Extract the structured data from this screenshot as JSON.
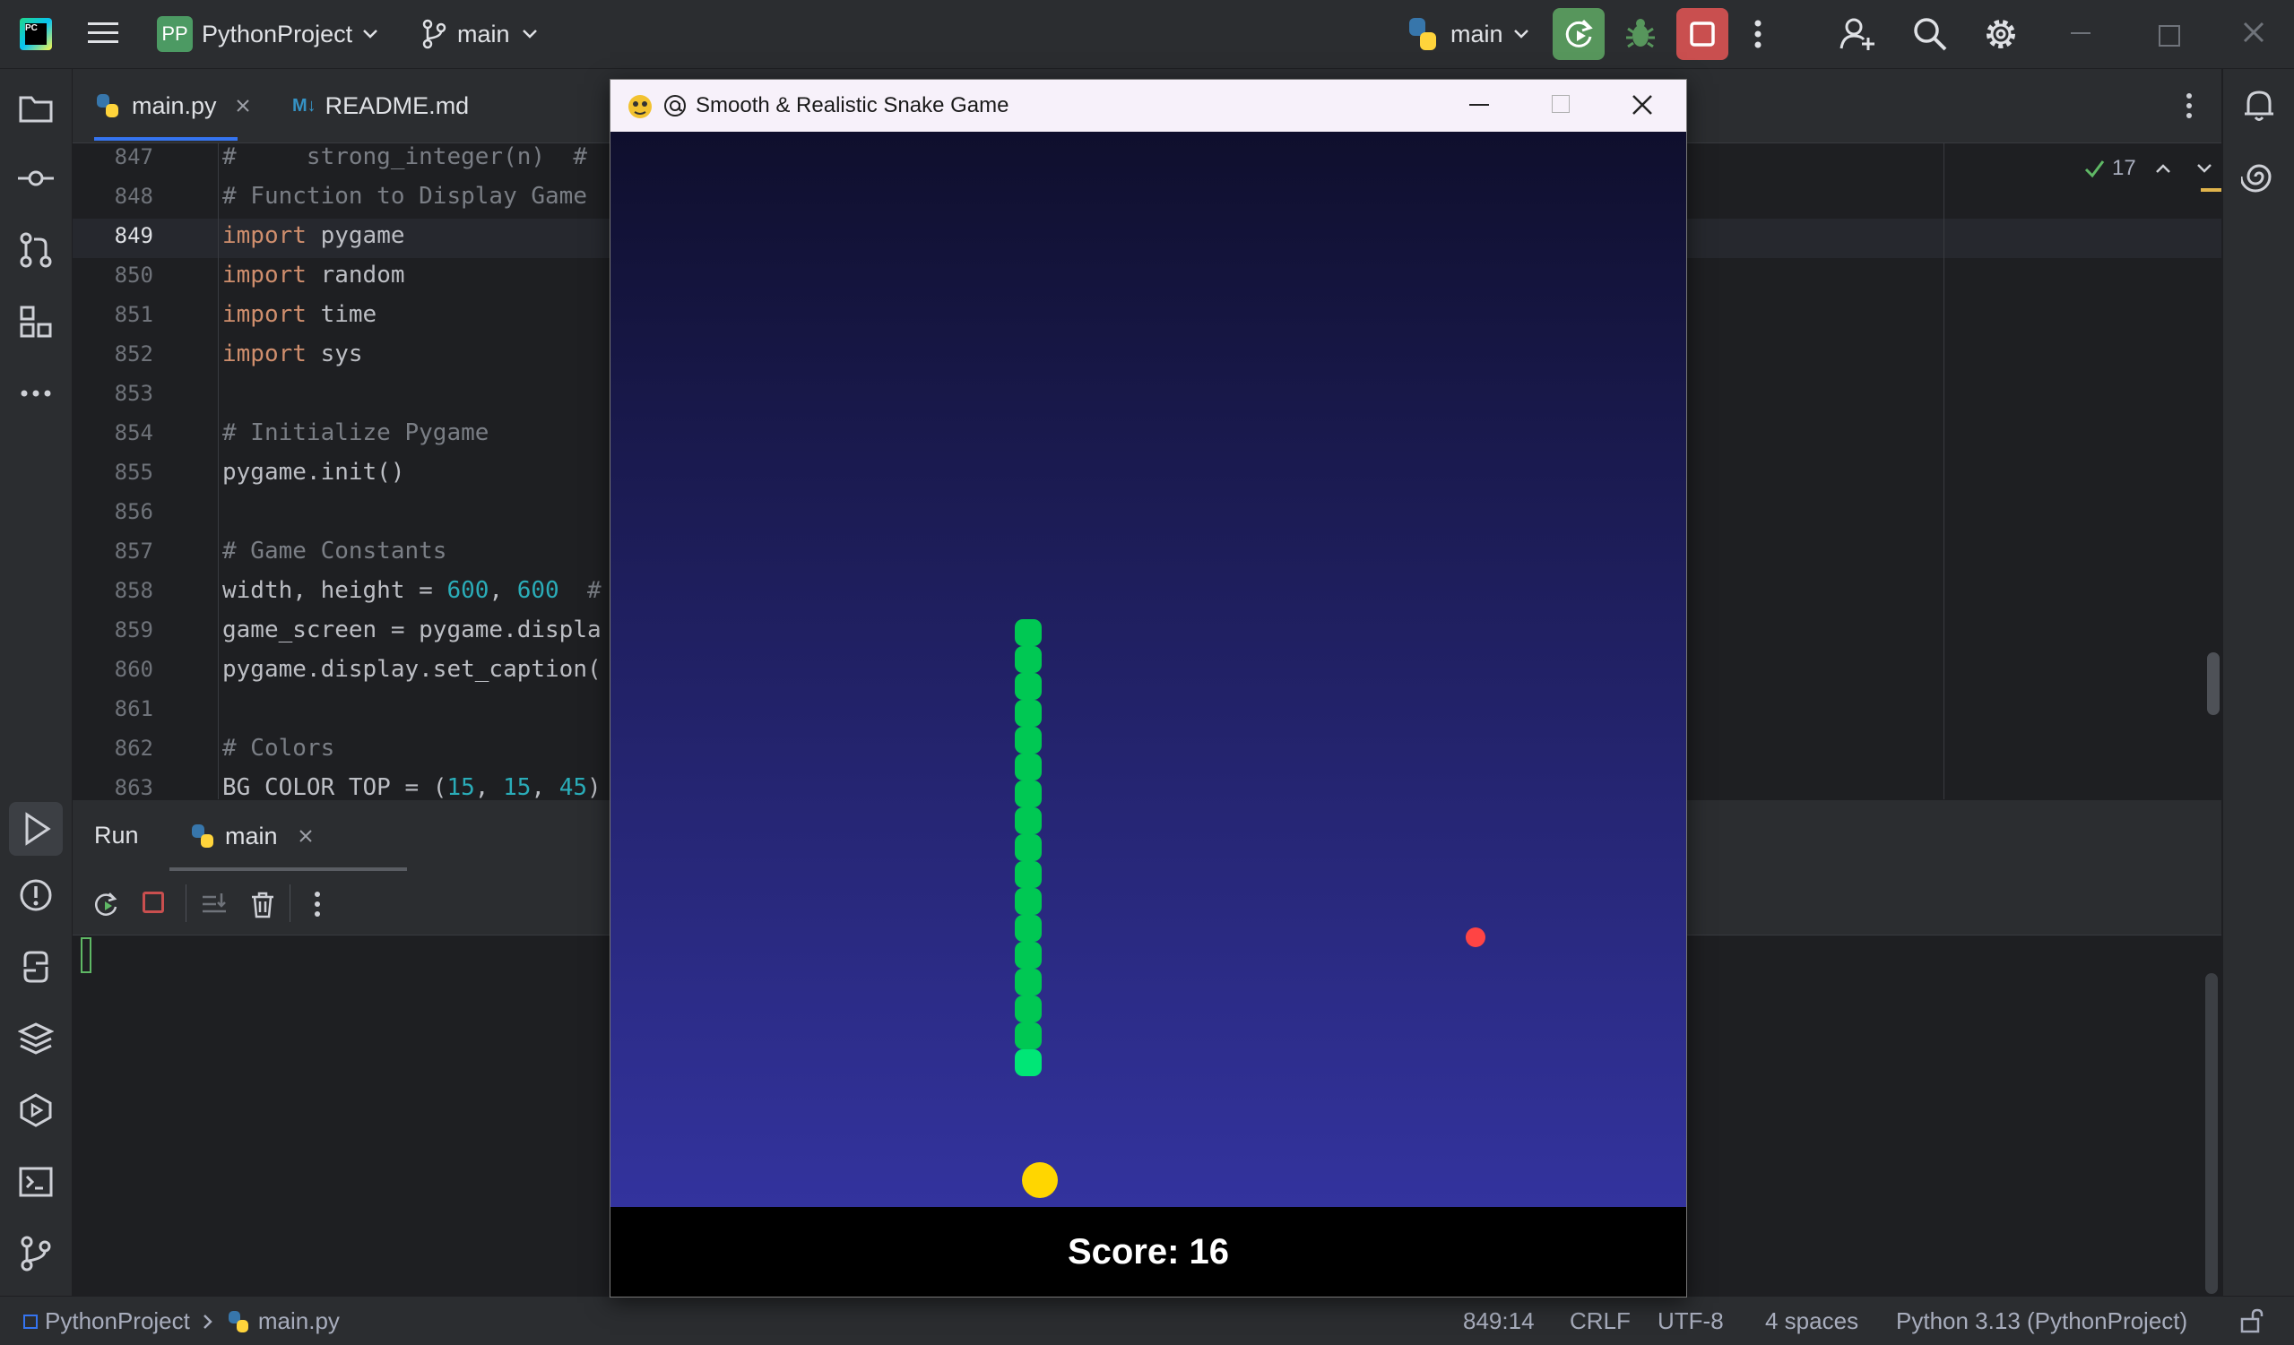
{
  "app": {
    "logo_text": "PC",
    "project_badge": "PP",
    "project_name": "PythonProject",
    "branch": "main",
    "run_config": "main"
  },
  "editor": {
    "tabs": [
      {
        "label": "main.py",
        "active": true
      },
      {
        "label": "README.md",
        "active": false
      }
    ],
    "inspection_count": "17",
    "lines": [
      {
        "num": "847",
        "text": "#     strong_integer(n)  #"
      },
      {
        "num": "848",
        "text": "# Function to Display Game"
      },
      {
        "num": "849",
        "text": "import pygame"
      },
      {
        "num": "850",
        "text": "import random"
      },
      {
        "num": "851",
        "text": "import time"
      },
      {
        "num": "852",
        "text": "import sys"
      },
      {
        "num": "853",
        "text": ""
      },
      {
        "num": "854",
        "text": "# Initialize Pygame"
      },
      {
        "num": "855",
        "text": "pygame.init()"
      },
      {
        "num": "856",
        "text": ""
      },
      {
        "num": "857",
        "text": "# Game Constants"
      },
      {
        "num": "858",
        "text": "width, height = 600, 600  #"
      },
      {
        "num": "859",
        "text": "game_screen = pygame.displa"
      },
      {
        "num": "860",
        "text": "pygame.display.set_caption("
      },
      {
        "num": "861",
        "text": ""
      },
      {
        "num": "862",
        "text": "# Colors"
      },
      {
        "num": "863",
        "text": "BG_COLOR_TOP = (15, 15, 45)"
      }
    ]
  },
  "run_panel": {
    "title": "Run",
    "tab_label": "main"
  },
  "statusbar": {
    "project": "PythonProject",
    "file": "main.py",
    "position": "849:14",
    "line_sep": "CRLF",
    "encoding": "UTF-8",
    "indent": "4 spaces",
    "interpreter": "Python 3.13 (PythonProject)"
  },
  "game": {
    "window_title": "Smooth & Realistic Snake Game",
    "score_text": "Score: 16",
    "bg_top": "#0f0f2d",
    "bg_bottom": "#33339e",
    "snake_color": "#00c853",
    "snake_head_color": "#00e676",
    "food_color": "#ffd600",
    "bonus_color": "#ff4444",
    "snake_segments": 17
  }
}
